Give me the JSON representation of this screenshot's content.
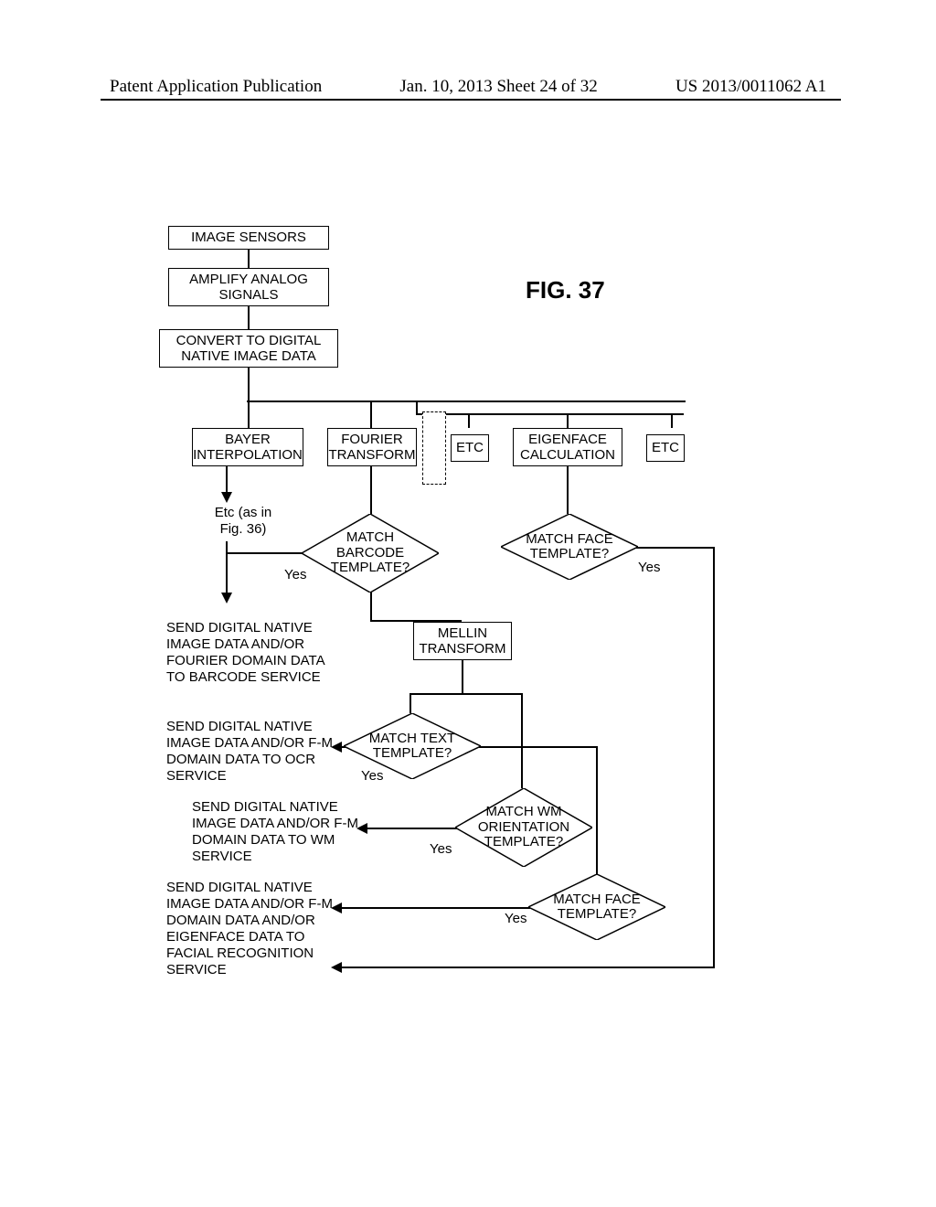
{
  "header": {
    "left": "Patent Application Publication",
    "center": "Jan. 10, 2013  Sheet 24 of 32",
    "right": "US 2013/0011062 A1"
  },
  "figureLabel": "FIG. 37",
  "boxes": {
    "imageSensors": "IMAGE SENSORS",
    "amplify": "AMPLIFY ANALOG\nSIGNALS",
    "convert": "CONVERT TO DIGITAL\nNATIVE IMAGE DATA",
    "bayer": "BAYER\nINTERPOLATION",
    "fourier": "FOURIER\nTRANSFORM",
    "etc1": "ETC",
    "eigenface": "EIGENFACE\nCALCULATION",
    "etc2": "ETC",
    "mellin": "MELLIN\nTRANSFORM",
    "etcNote": "Etc (as in\nFig. 36)"
  },
  "diamonds": {
    "barcode": "MATCH\nBARCODE\nTEMPLATE?",
    "face1": "MATCH FACE\nTEMPLATE?",
    "text": "MATCH TEXT\nTEMPLATE?",
    "wm": "MATCH WM\nORIENTATION\nTEMPLATE?",
    "face2": "MATCH FACE\nTEMPLATE?"
  },
  "yes": "Yes",
  "actions": {
    "barcodeSvc": "SEND DIGITAL NATIVE\nIMAGE DATA AND/OR\nFOURIER DOMAIN DATA\nTO BARCODE SERVICE",
    "ocrSvc": "SEND DIGITAL NATIVE\nIMAGE DATA AND/OR F-M\nDOMAIN DATA TO OCR\nSERVICE",
    "wmSvc": "SEND DIGITAL NATIVE\nIMAGE DATA AND/OR F-M\nDOMAIN DATA TO WM\nSERVICE",
    "faceSvc": "SEND DIGITAL NATIVE\nIMAGE DATA AND/OR F-M\nDOMAIN DATA AND/OR\nEIGENFACE DATA TO\nFACIAL RECOGNITION\nSERVICE"
  }
}
